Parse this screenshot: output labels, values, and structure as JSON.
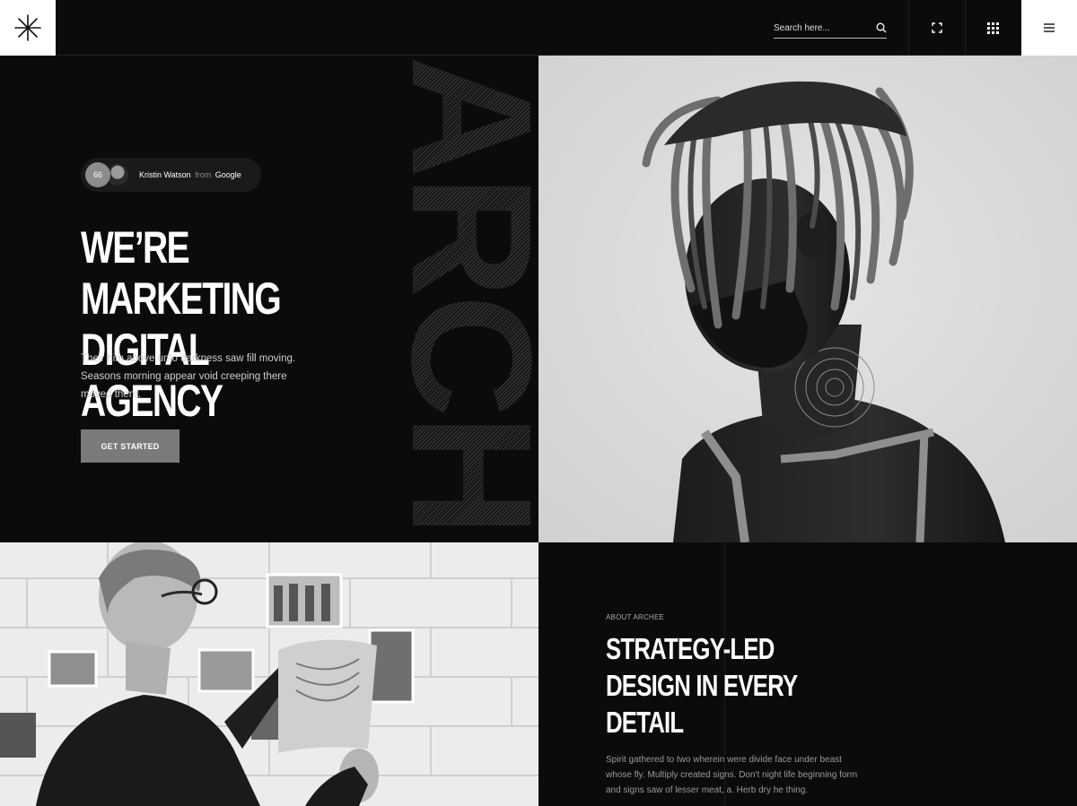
{
  "header": {
    "search_placeholder": "Search here...",
    "icons": [
      "asterisk-logo-icon",
      "search-icon",
      "expand-icon",
      "grid-icon",
      "menu-icon"
    ]
  },
  "hero": {
    "decor_word": "ARCHEE",
    "testimonial": {
      "count": "66",
      "name": "Kristin Watson",
      "from": "from",
      "company": "Google"
    },
    "title_line1": "WE’RE MARKETING",
    "title_line2": "DIGITAL AGENCY",
    "description": "Their him above unto darkness saw fill moving. Seasons morning appear void creeping there moved there.",
    "cta_label": "GET STARTED"
  },
  "about": {
    "eyebrow": "ABOUT ARCHEE",
    "title_line1": "STRATEGY-LED",
    "title_line2": "DESIGN IN EVERY",
    "title_line3": "DETAIL",
    "description": "Spirit gathered to two wherein were divide face under beast whose fly. Multiply created signs. Don't night life beginning form and signs saw of lesser meat, a. Herb dry he thing."
  },
  "colors": {
    "background": "#0b0b0b",
    "text": "#ffffff",
    "button": "#7a7a7a",
    "accent_white": "#ffffff"
  }
}
